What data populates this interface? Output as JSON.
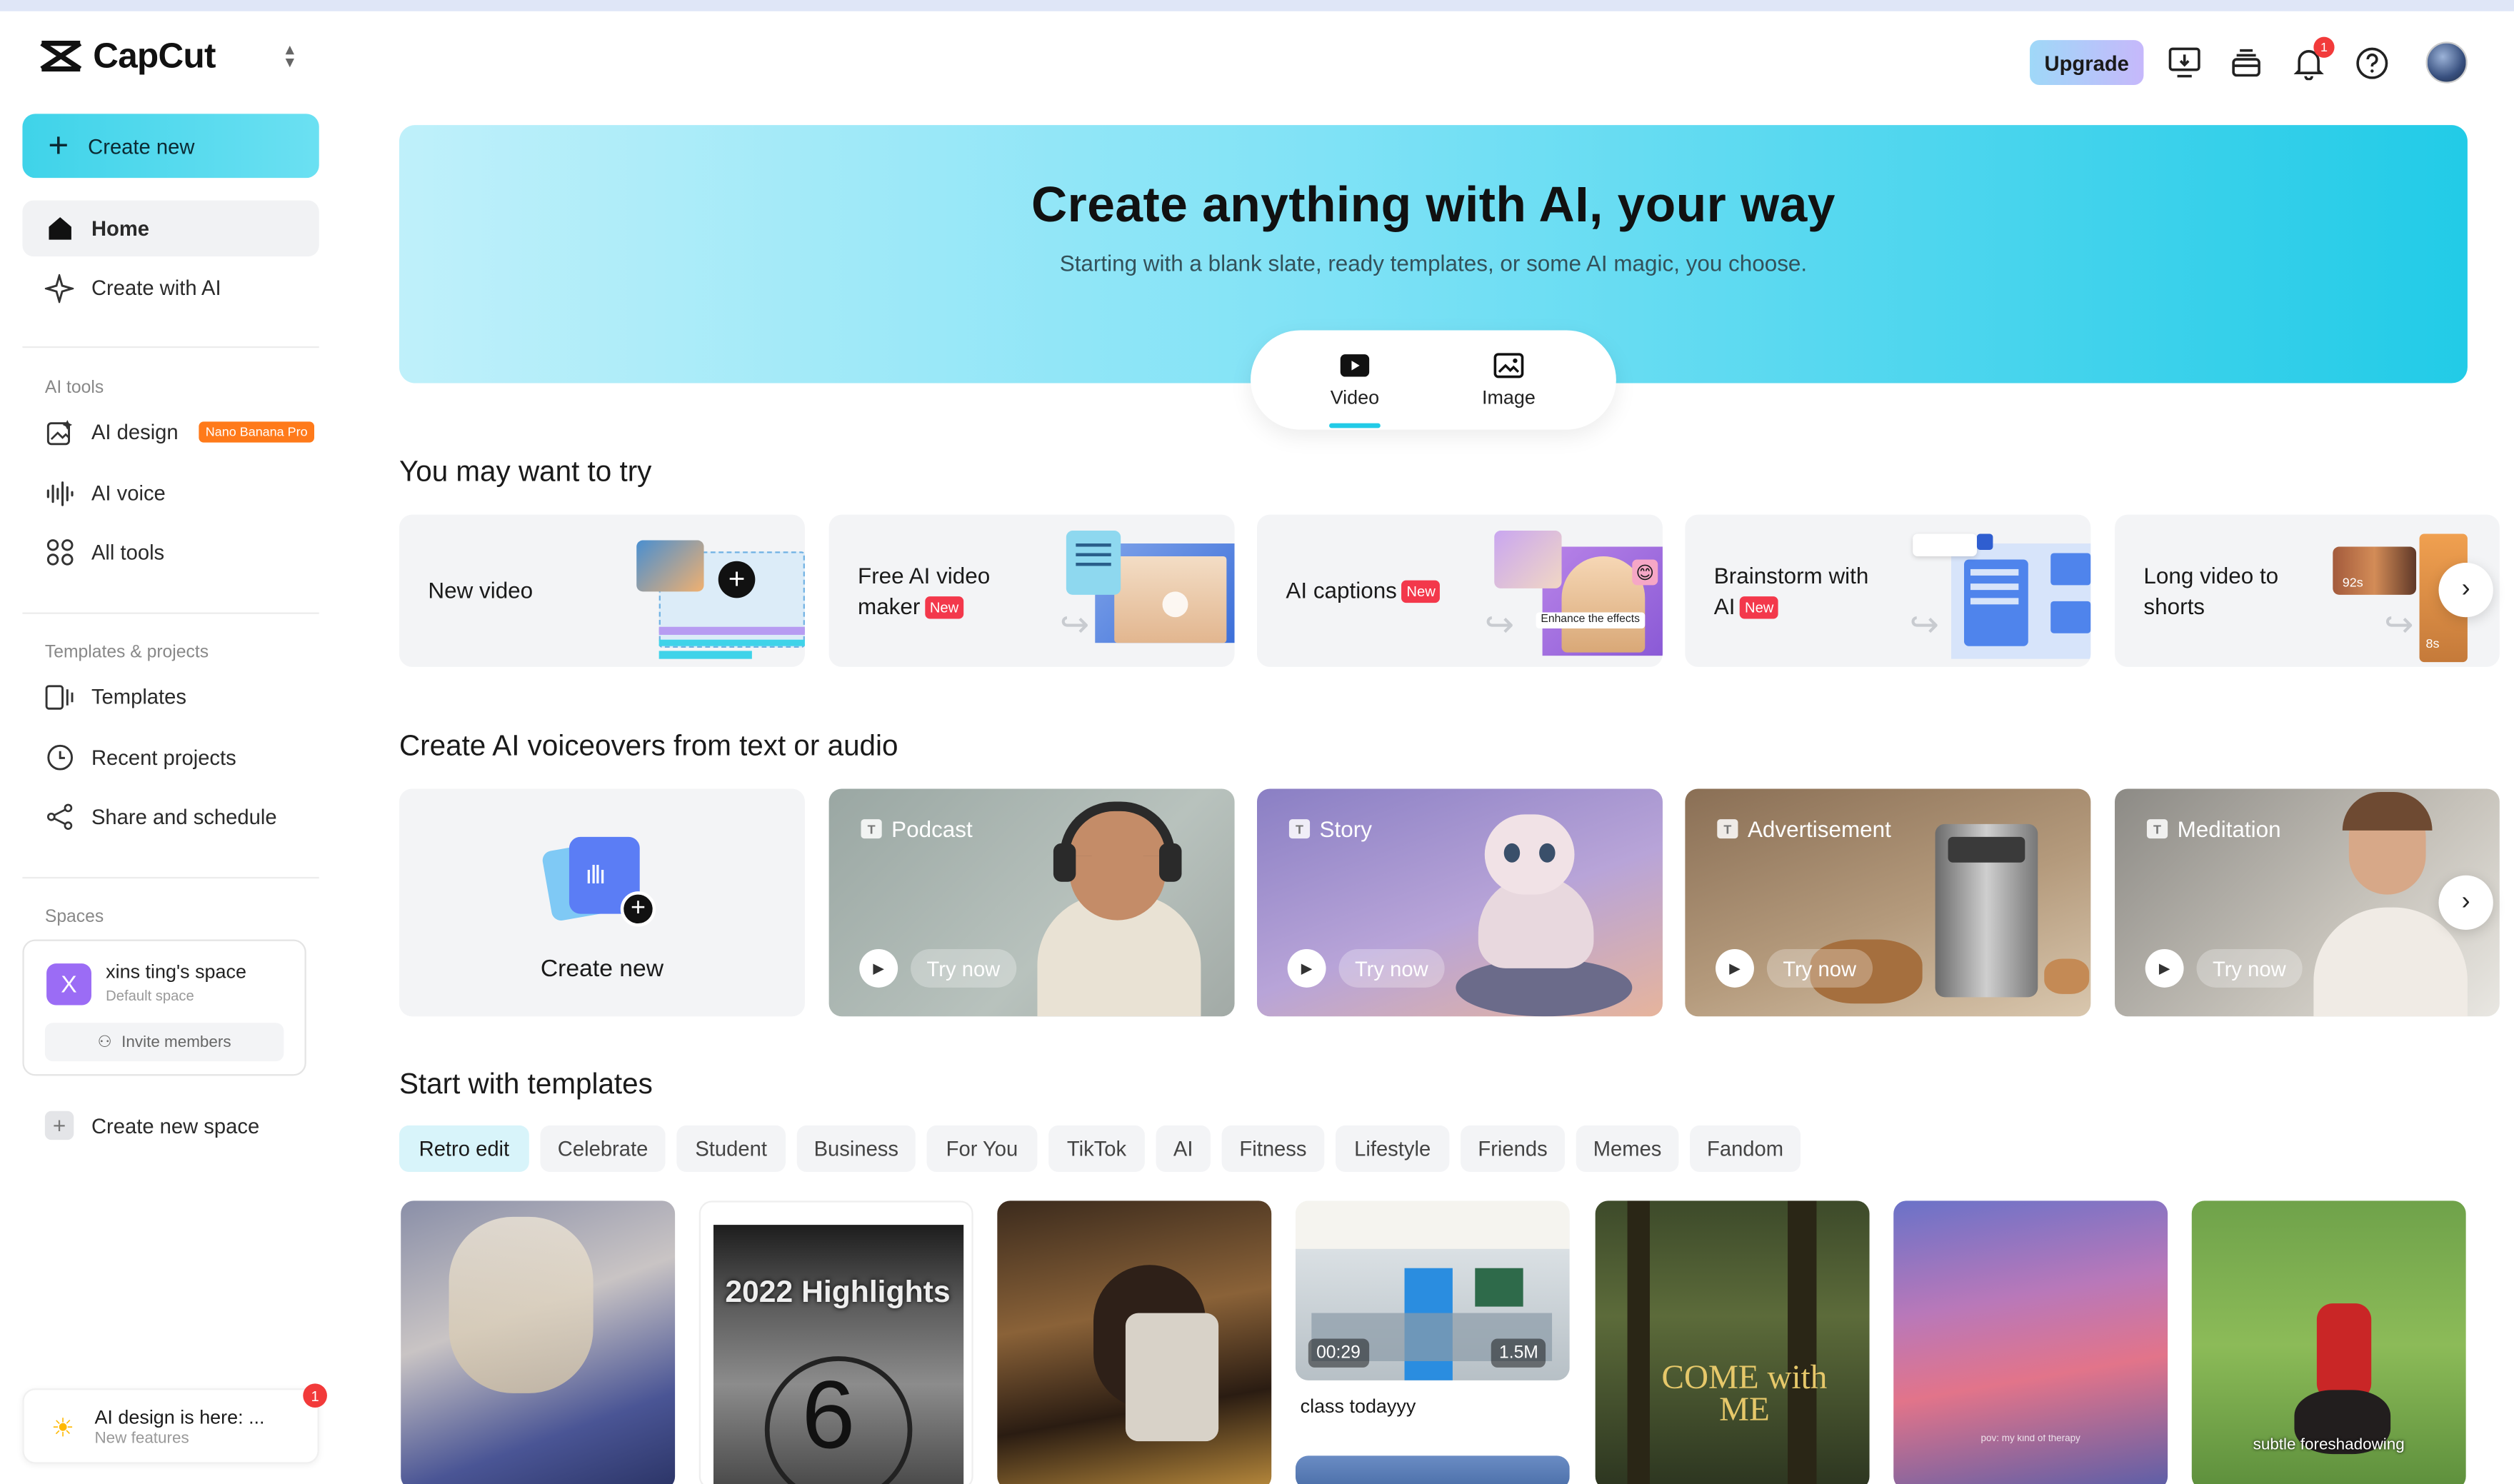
{
  "app": {
    "name": "CapCut"
  },
  "sidebar": {
    "create_new": "Create new",
    "nav": [
      {
        "label": "Home"
      },
      {
        "label": "Create with AI"
      }
    ],
    "ai_tools_title": "AI tools",
    "ai_tools": [
      {
        "label": "AI design",
        "badge": "Nano Banana Pro"
      },
      {
        "label": "AI voice"
      },
      {
        "label": "All tools"
      }
    ],
    "templates_title": "Templates & projects",
    "templates_items": [
      {
        "label": "Templates"
      },
      {
        "label": "Recent projects"
      },
      {
        "label": "Share and schedule"
      }
    ],
    "spaces_title": "Spaces",
    "space": {
      "initial": "X",
      "name": "xins ting's space",
      "sub": "Default space",
      "invite": "Invite members"
    },
    "create_space": "Create new space",
    "notice": {
      "title": "AI design is here: ...",
      "sub": "New features",
      "count": "1"
    }
  },
  "header": {
    "upgrade": "Upgrade",
    "notifications": "1"
  },
  "hero": {
    "title": "Create anything with AI, your way",
    "subtitle": "Starting with a blank slate, ready templates, or some AI magic, you choose.",
    "tabs": [
      {
        "label": "Video"
      },
      {
        "label": "Image"
      }
    ]
  },
  "try_section": {
    "title": "You may want to try",
    "cards": [
      {
        "l1": "New video",
        "l2": "",
        "tag": ""
      },
      {
        "l1": "Free AI video",
        "l2": "maker",
        "tag": "New"
      },
      {
        "l1": "AI captions",
        "l2": "",
        "tag": "New",
        "overlay": "Enhance the effects"
      },
      {
        "l1": "Brainstorm with",
        "l2": "AI",
        "tag": "New"
      },
      {
        "l1": "Long video to",
        "l2": "shorts",
        "tag": "",
        "overlay": "92s",
        "overlay2": "8s"
      }
    ]
  },
  "voice_section": {
    "title": "Create AI voiceovers from text or audio",
    "create_label": "Create new",
    "try_label": "Try now",
    "cards": [
      {
        "label": "Podcast"
      },
      {
        "label": "Story"
      },
      {
        "label": "Advertisement"
      },
      {
        "label": "Meditation"
      }
    ]
  },
  "templates_section": {
    "title": "Start with templates",
    "chips": [
      "Retro edit",
      "Celebrate",
      "Student",
      "Business",
      "For You",
      "TikTok",
      "AI",
      "Fitness",
      "Lifestyle",
      "Friends",
      "Memes",
      "Fandom"
    ],
    "cards": [
      {
        "caption": "",
        "overlay": ""
      },
      {
        "caption": "",
        "overlay": "2022 Highlights"
      },
      {
        "caption": "",
        "overlay": ""
      },
      {
        "caption": "class todayyy",
        "duration": "00:29",
        "views": "1.5M"
      },
      {
        "caption": "",
        "overlay": "COME with ME"
      },
      {
        "caption": "",
        "overlay": "pov: my kind of therapy"
      },
      {
        "caption": "",
        "overlay": "subtle foreshadowing"
      }
    ]
  }
}
